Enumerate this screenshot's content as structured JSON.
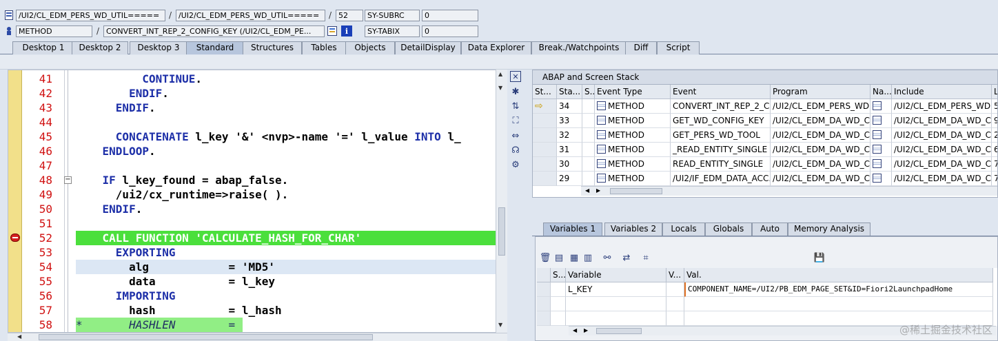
{
  "header": {
    "row1": {
      "program": "/UI2/CL_EDM_PERS_WD_UTIL=====",
      "include": "/UI2/CL_EDM_PERS_WD_UTIL=====",
      "line": "52",
      "sysfield_name": "SY-SUBRC",
      "sysfield_value": "0"
    },
    "row2": {
      "event_type": "METHOD",
      "event": "CONVERT_INT_REP_2_CONFIG_KEY (/UI2/CL_EDM_PE...",
      "sysfield_name": "SY-TABIX",
      "sysfield_value": "0"
    },
    "separator": "/"
  },
  "tabs": [
    "Desktop 1",
    "Desktop 2",
    "Desktop 3",
    "Standard",
    "Structures",
    "Tables",
    "Objects",
    "DetailDisplay",
    "Data Explorer",
    "Break./Watchpoints",
    "Diff",
    "Script"
  ],
  "active_tab": "Standard",
  "editor": {
    "lines": [
      {
        "no": "41",
        "segments": [
          {
            "t": "          ",
            "c": ""
          },
          {
            "t": "CONTINUE",
            "c": "kw"
          },
          {
            "t": ".",
            "c": ""
          }
        ]
      },
      {
        "no": "42",
        "segments": [
          {
            "t": "        ",
            "c": ""
          },
          {
            "t": "ENDIF",
            "c": "kw"
          },
          {
            "t": ".",
            "c": ""
          }
        ]
      },
      {
        "no": "43",
        "segments": [
          {
            "t": "      ",
            "c": ""
          },
          {
            "t": "ENDIF",
            "c": "kw"
          },
          {
            "t": ".",
            "c": ""
          }
        ]
      },
      {
        "no": "44",
        "segments": []
      },
      {
        "no": "45",
        "segments": [
          {
            "t": "      ",
            "c": ""
          },
          {
            "t": "CONCATENATE",
            "c": "kw"
          },
          {
            "t": " l_key '&' <nvp>-name '=' l_value ",
            "c": ""
          },
          {
            "t": "INTO",
            "c": "kw"
          },
          {
            "t": " l_",
            "c": ""
          }
        ]
      },
      {
        "no": "46",
        "segments": [
          {
            "t": "    ",
            "c": ""
          },
          {
            "t": "ENDLOOP",
            "c": "kw"
          },
          {
            "t": ".",
            "c": ""
          }
        ]
      },
      {
        "no": "47",
        "segments": []
      },
      {
        "no": "48",
        "segments": [
          {
            "t": "    ",
            "c": ""
          },
          {
            "t": "IF",
            "c": "kw"
          },
          {
            "t": " l_key_found = abap_false.",
            "c": ""
          }
        ]
      },
      {
        "no": "49",
        "segments": [
          {
            "t": "      /ui2/cx_runtime=>raise( ).",
            "c": ""
          }
        ]
      },
      {
        "no": "50",
        "segments": [
          {
            "t": "    ",
            "c": ""
          },
          {
            "t": "ENDIF",
            "c": "kw"
          },
          {
            "t": ".",
            "c": ""
          }
        ]
      },
      {
        "no": "51",
        "segments": []
      },
      {
        "no": "52",
        "segments": [
          {
            "t": "    CALL FUNCTION 'CALCULATE_HASH_FOR_CHAR'",
            "c": "w"
          }
        ]
      },
      {
        "no": "53",
        "segments": [
          {
            "t": "      ",
            "c": ""
          },
          {
            "t": "EXPORTING",
            "c": "kw"
          }
        ]
      },
      {
        "no": "54",
        "segments": [
          {
            "t": "        alg            = 'MD5'",
            "c": ""
          }
        ]
      },
      {
        "no": "55",
        "segments": [
          {
            "t": "        data           = l_key",
            "c": ""
          }
        ]
      },
      {
        "no": "56",
        "segments": [
          {
            "t": "      ",
            "c": ""
          },
          {
            "t": "IMPORTING",
            "c": "kw"
          }
        ]
      },
      {
        "no": "57",
        "segments": [
          {
            "t": "        hash           = l_hash",
            "c": ""
          }
        ]
      },
      {
        "no": "58",
        "segments": [
          {
            "t": "*       HASHLEN        =",
            "c": "cm"
          }
        ]
      }
    ],
    "current_line": "52"
  },
  "stack": {
    "title": "ABAP and Screen Stack",
    "columns": [
      "St...",
      "Sta...",
      "S...",
      "Event Type",
      "Event",
      "Program",
      "Na...",
      "Include",
      "L"
    ],
    "rows": [
      {
        "level": "34",
        "type": "METHOD",
        "event": "CONVERT_INT_REP_2_C...",
        "program": "/UI2/CL_EDM_PERS_WD...",
        "include": "/UI2/CL_EDM_PERS_WD...",
        "l": "5",
        "current": true
      },
      {
        "level": "33",
        "type": "METHOD",
        "event": "GET_WD_CONFIG_KEY",
        "program": "/UI2/CL_EDM_DA_WD_C...",
        "include": "/UI2/CL_EDM_DA_WD_C...",
        "l": "9",
        "current": false
      },
      {
        "level": "32",
        "type": "METHOD",
        "event": "GET_PERS_WD_TOOL",
        "program": "/UI2/CL_EDM_DA_WD_C...",
        "include": "/UI2/CL_EDM_DA_WD_C...",
        "l": "2",
        "current": false
      },
      {
        "level": "31",
        "type": "METHOD",
        "event": "_READ_ENTITY_SINGLE",
        "program": "/UI2/CL_EDM_DA_WD_C...",
        "include": "/UI2/CL_EDM_DA_WD_C...",
        "l": "6",
        "current": false
      },
      {
        "level": "30",
        "type": "METHOD",
        "event": "READ_ENTITY_SINGLE",
        "program": "/UI2/CL_EDM_DA_WD_C...",
        "include": "/UI2/CL_EDM_DA_WD_C...",
        "l": "7",
        "current": false
      },
      {
        "level": "29",
        "type": "METHOD",
        "event": "/UI2/IF_EDM_DATA_ACC...",
        "program": "/UI2/CL_EDM_DA_WD_C...",
        "include": "/UI2/CL_EDM_DA_WD_C...",
        "l": "7",
        "current": false
      }
    ]
  },
  "var_tabs": [
    "Variables 1",
    "Variables 2",
    "Locals",
    "Globals",
    "Auto",
    "Memory Analysis"
  ],
  "active_var_tab": "Variables 1",
  "variables": {
    "columns": [
      "S...",
      "Variable",
      "V...",
      "Val."
    ],
    "rows": [
      {
        "variable": "L_KEY",
        "value": "COMPONENT_NAME=/UI2/PB_EDM_PAGE_SET&ID=Fiori2LaunchpadHome"
      }
    ]
  },
  "watermark": "@稀土掘金技术社区",
  "colors": {
    "keyword": "#1d2fa8",
    "current_line": "#4bdf3c",
    "line_number": "#d01010",
    "gutter": "#f2e08a"
  }
}
